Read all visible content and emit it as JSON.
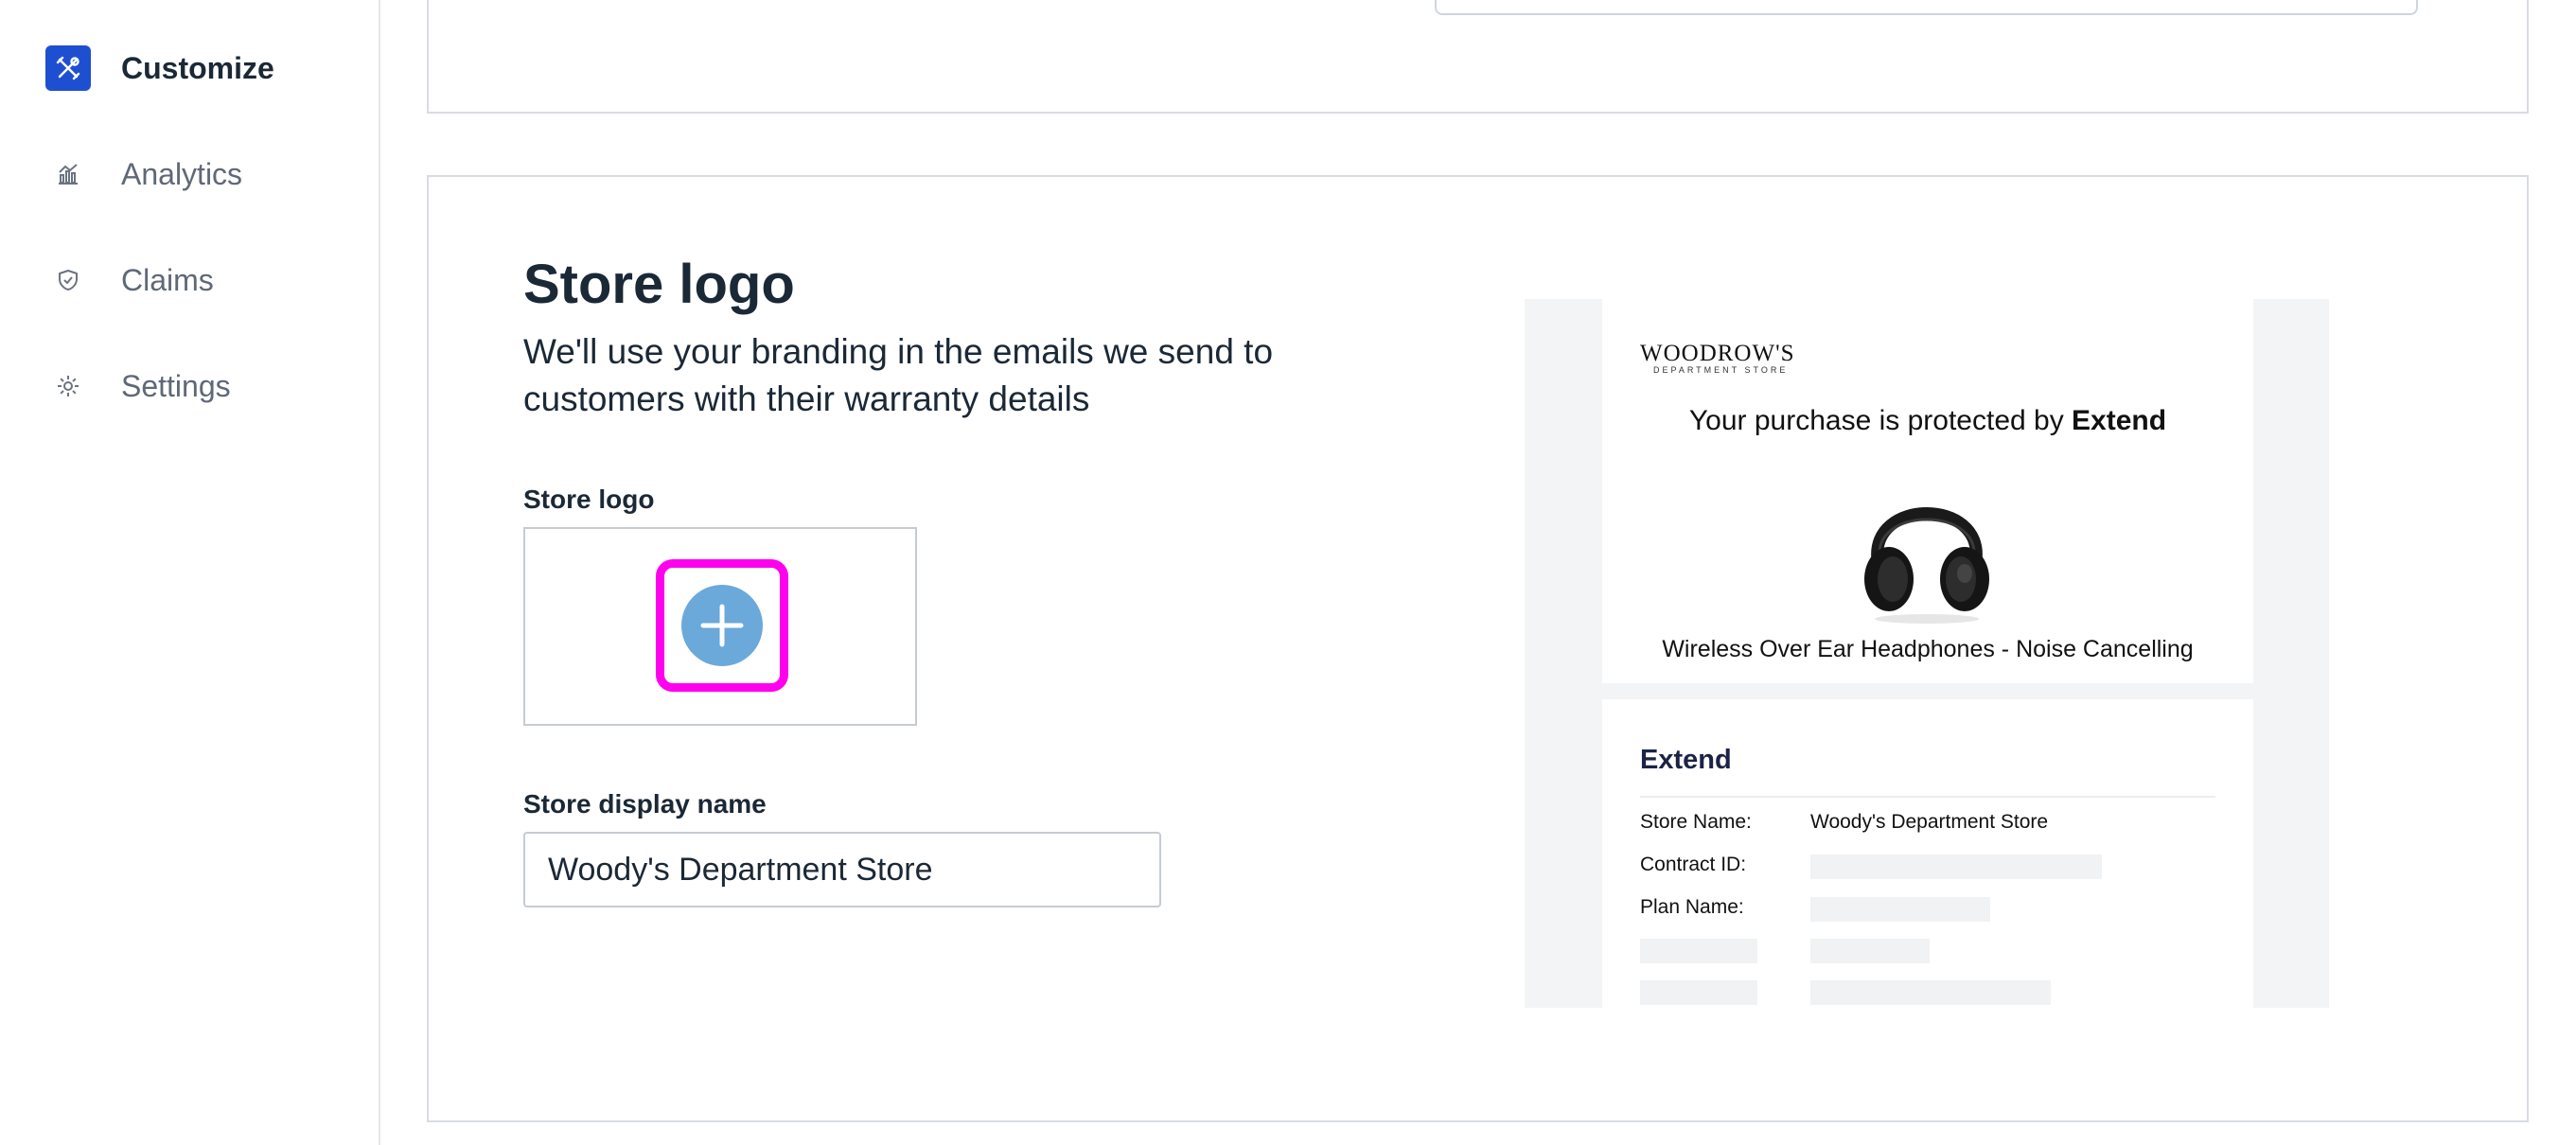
{
  "sidebar": {
    "items": [
      {
        "label": "Customize",
        "icon": "tools-icon",
        "active": true
      },
      {
        "label": "Analytics",
        "icon": "analytics-icon",
        "active": false
      },
      {
        "label": "Claims",
        "icon": "shield-icon",
        "active": false
      },
      {
        "label": "Settings",
        "icon": "gear-icon",
        "active": false
      }
    ]
  },
  "store_logo_section": {
    "title": "Store logo",
    "subtitle": "We'll use your branding in the emails we send to customers with their warranty details",
    "logo_field_label": "Store logo",
    "upload_icon": "plus-icon",
    "display_name_label": "Store display name",
    "display_name_value": "Woody's Department Store"
  },
  "email_preview": {
    "brand_name": "WOODROW'S",
    "brand_sub": "DEPARTMENT STORE",
    "protected_prefix": "Your purchase is protected by ",
    "protected_brand": "Extend",
    "product_image": "headphones-image",
    "product_name": "Wireless Over Ear Headphones - Noise Cancelling",
    "extend_brand": "Extend",
    "rows": [
      {
        "label": "Store Name:",
        "value": "Woody's Department Store"
      },
      {
        "label": "Contract ID:",
        "value": ""
      },
      {
        "label": "Plan Name:",
        "value": ""
      }
    ]
  },
  "colors": {
    "accent": "#1f4fd1",
    "upload_highlight": "#ff00ee",
    "plus_circle": "#6aa9da",
    "text": "#1b2836",
    "muted": "#5f6876"
  }
}
